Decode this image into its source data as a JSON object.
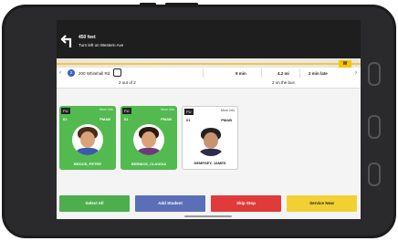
{
  "navigation": {
    "distance": "450 feet",
    "instruction": "Turn left on Western Ave"
  },
  "map": {
    "logo_text": "W"
  },
  "stop_info": {
    "stop_number": "2",
    "address": "200 Whitehall Rd",
    "time": "9 min",
    "miles": "4.2 mi",
    "status": "2 min late",
    "progress": "2 out of 2",
    "on_bus": "2 on the bus"
  },
  "cards": [
    {
      "pu": "PU",
      "more": "More Info",
      "grade": "01",
      "level": "PMAB",
      "name": "BROCE, PETRE",
      "color": "green"
    },
    {
      "pu": "PU",
      "more": "More Info",
      "grade": "01",
      "level": "PMAB",
      "name": "BERNICE, CLAUDIA",
      "color": "green"
    },
    {
      "pu": "PU",
      "more": "More Info",
      "grade": "01",
      "level": "PMAB",
      "name": "DEMPSEY, JAMES",
      "color": "white"
    }
  ],
  "actions": {
    "select_all": "Select All",
    "add_student": "Add Student",
    "skip_stop": "Skip Stop",
    "service_now": "Service Now"
  }
}
